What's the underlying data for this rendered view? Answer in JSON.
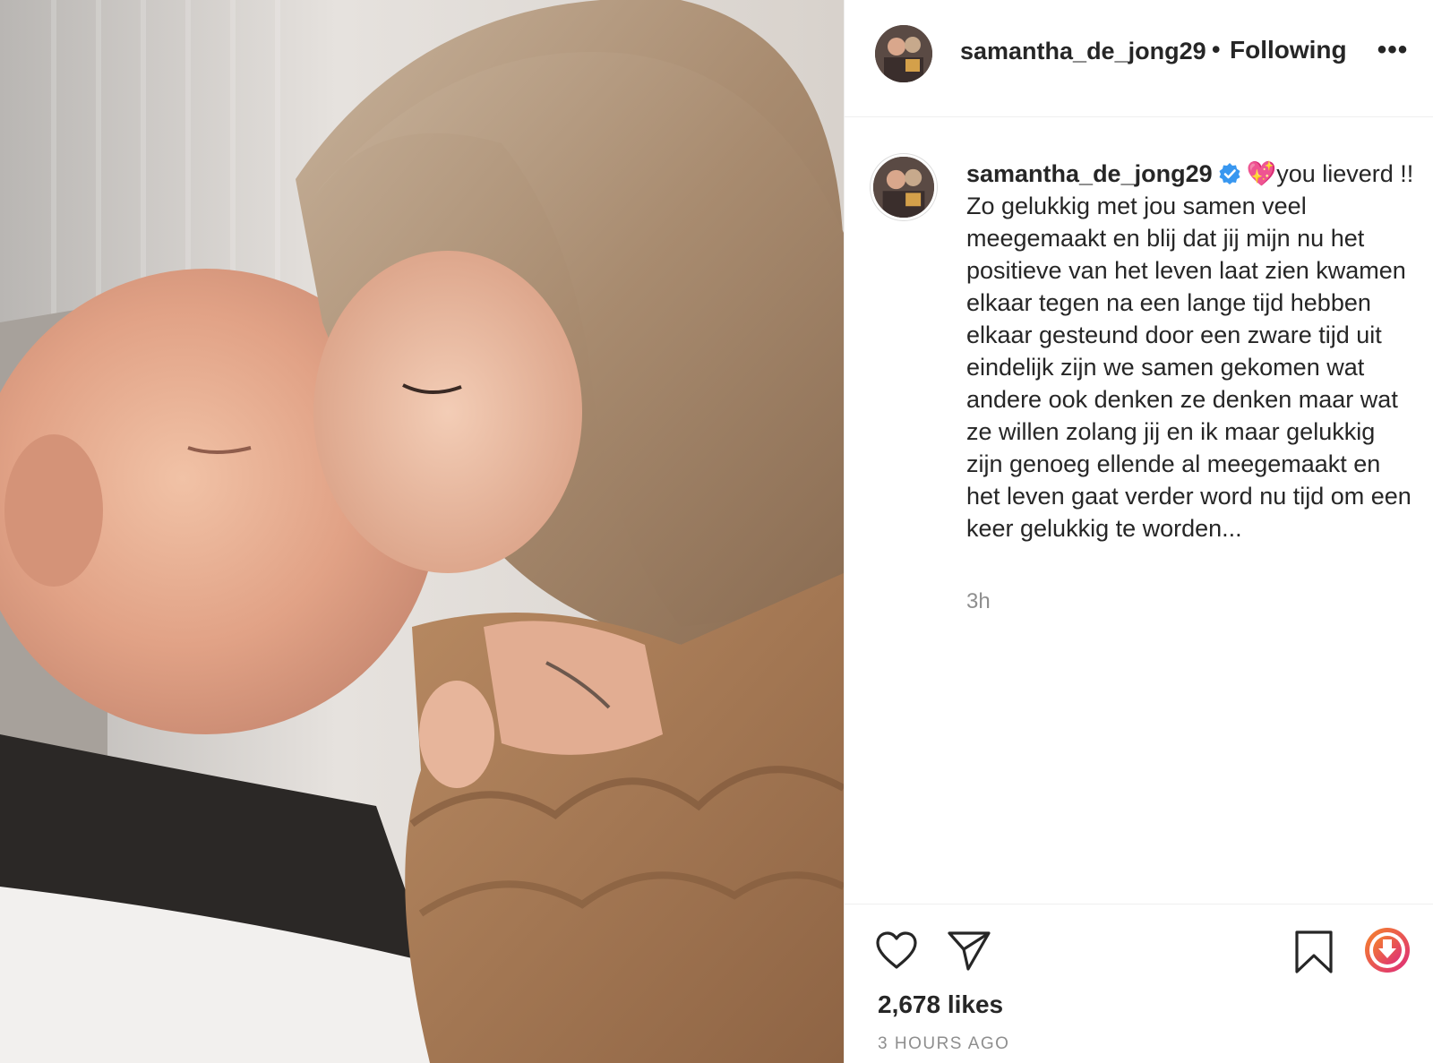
{
  "header": {
    "username": "samantha_de_jong29",
    "separator": "•",
    "follow_status": "Following",
    "more_label": "•••"
  },
  "caption": {
    "username": "samantha_de_jong29",
    "verified": true,
    "emoji": "💖",
    "text": "you lieverd !! Zo gelukkig met jou samen veel meegemaakt en blij dat jij mijn nu het positieve van het leven laat zien kwamen elkaar tegen na een lange tijd hebben elkaar gesteund door een zware tijd uit eindelijk zijn we samen gekomen wat andere ook denken ze denken maar wat ze willen zolang jij en ik maar gelukkig zijn genoeg ellende al meegemaakt en het leven gaat verder word nu tijd om een keer gelukkig te worden...",
    "time": "3h"
  },
  "actions": {
    "like_icon": "heart-outline-icon",
    "share_icon": "paper-plane-icon",
    "save_icon": "bookmark-icon",
    "download_icon": "download-icon"
  },
  "likes_count": "2,678 likes",
  "posted_ago": "3 HOURS AGO",
  "colors": {
    "text": "#262626",
    "muted": "#8e8e8e",
    "verified": "#3897f0",
    "divider": "#efefef",
    "download_gradient_start": "#f58529",
    "download_gradient_end": "#dd2a7b"
  }
}
